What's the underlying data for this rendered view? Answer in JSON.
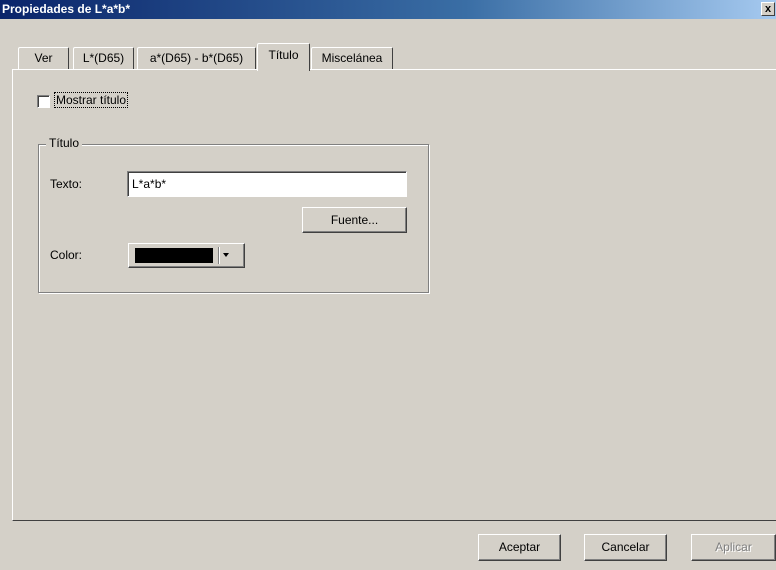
{
  "window": {
    "title": "Propiedades de L*a*b*",
    "close_symbol": "x"
  },
  "tabs": [
    {
      "label": "Ver",
      "active": false
    },
    {
      "label": "L*(D65)",
      "active": false
    },
    {
      "label": "a*(D65) - b*(D65)",
      "active": false
    },
    {
      "label": "Título",
      "active": true
    },
    {
      "label": "Miscelánea",
      "active": false
    }
  ],
  "show_title": {
    "label": "Mostrar título",
    "checked": false
  },
  "title_group": {
    "legend": "Título",
    "text_label": "Texto:",
    "text_value": "L*a*b*",
    "font_button": "Fuente...",
    "color_label": "Color:",
    "color_value": "#000000"
  },
  "footer": {
    "ok": "Aceptar",
    "cancel": "Cancelar",
    "apply": "Aplicar"
  }
}
